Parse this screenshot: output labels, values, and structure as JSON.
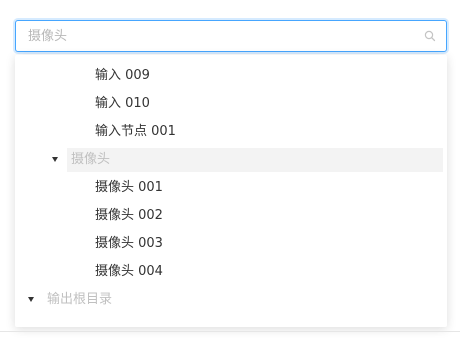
{
  "search": {
    "placeholder": "摄像头",
    "value": ""
  },
  "tree": {
    "items": [
      {
        "label": "输入 009"
      },
      {
        "label": "输入 010"
      },
      {
        "label": "输入节点 001"
      },
      {
        "label": "摄像头"
      },
      {
        "label": "摄像头 001"
      },
      {
        "label": "摄像头 002"
      },
      {
        "label": "摄像头 003"
      },
      {
        "label": "摄像头 004"
      },
      {
        "label": "输出根目录"
      }
    ]
  },
  "colors": {
    "accent": "#46a6ff",
    "disabled_text": "#c0c0c0",
    "highlight_bg": "#f3f3f3"
  }
}
